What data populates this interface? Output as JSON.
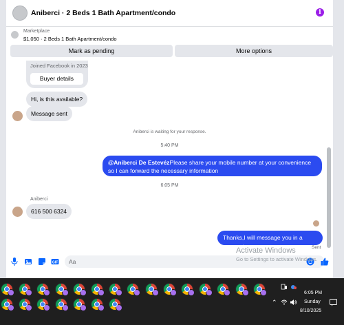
{
  "header": {
    "title": "Aniberci · 2 Beds 1 Bath Apartment/condo",
    "info_icon": "i"
  },
  "marketplace": {
    "label": "Marketplace",
    "listing": "$1,050 · 2 Beds 1 Bath Apartment/condo",
    "mark_pending": "Mark as pending",
    "more_options": "More options"
  },
  "messages": {
    "joined": "Joined Facebook in 2023",
    "buyer_details": "Buyer details",
    "msg1": "Hi, is this available?",
    "msg2": "Message sent",
    "waiting": "Aniberci is waiting for your response.",
    "time1": "5:40 PM",
    "out1_mention": "@Aniberci De Estevéz",
    "out1_text": "Please share your mobile number at your convenience so I can forward the necessary information",
    "time2": "6:05 PM",
    "sender": "Aniberci",
    "msg3": "616 500 6324",
    "out2": "Thanks,I will message you in a moment.",
    "sent": "Sent"
  },
  "composer": {
    "placeholder": "Aa"
  },
  "watermark": {
    "line1": "Activate Windows",
    "line2": "Go to Settings to activate Windows."
  },
  "taskbar": {
    "time": "6:05 PM",
    "day": "Sunday",
    "date": "8/10/2025",
    "row1_count": 15,
    "row2_count": 7
  },
  "colors": {
    "accent": "#0866ff",
    "outgoing_bubble": "#2b4bf0",
    "info_icon": "#9b1fe8"
  }
}
